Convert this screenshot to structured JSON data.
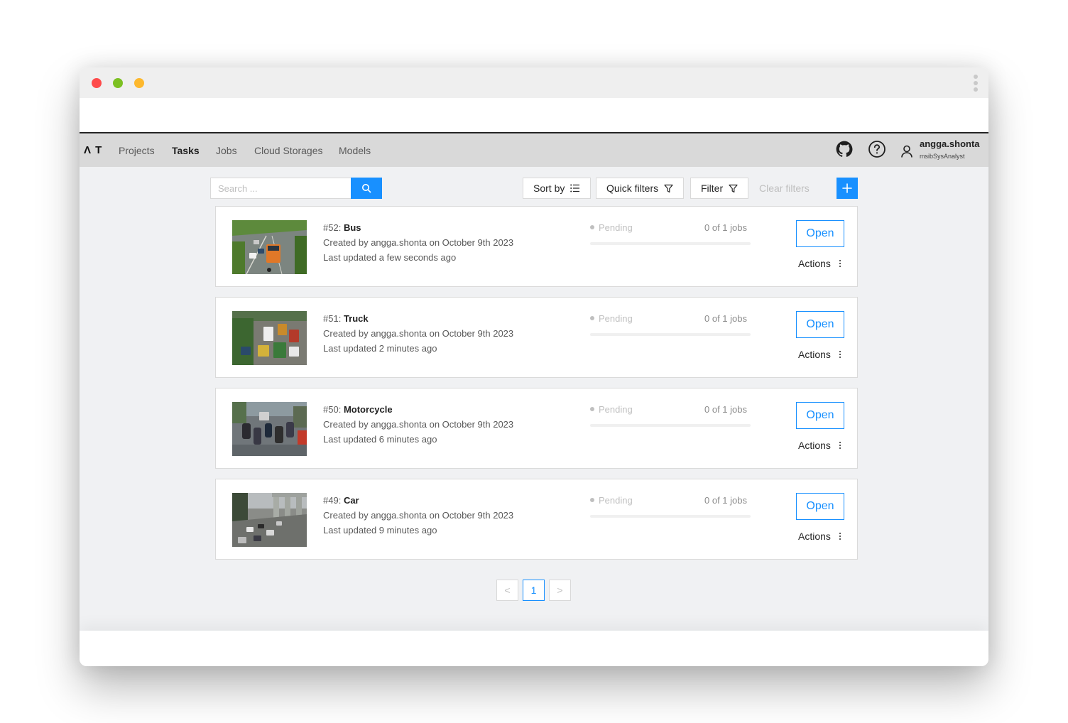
{
  "header": {
    "logo": "Λ T",
    "nav": [
      {
        "label": "Projects",
        "active": false
      },
      {
        "label": "Tasks",
        "active": true
      },
      {
        "label": "Jobs",
        "active": false
      },
      {
        "label": "Cloud Storages",
        "active": false
      },
      {
        "label": "Models",
        "active": false
      }
    ],
    "icons": [
      "github-icon",
      "help-icon",
      "user-icon"
    ],
    "user": {
      "name": "angga.shonta",
      "role": "msibSysAnalyst"
    }
  },
  "toolbar": {
    "search_placeholder": "Search ...",
    "sort_label": "Sort by",
    "quick_filters_label": "Quick filters",
    "filter_label": "Filter",
    "clear_filters_label": "Clear filters"
  },
  "tasks": [
    {
      "id": "#52:",
      "name": "Bus",
      "created": "Created by angga.shonta on October 9th 2023",
      "updated": "Last updated a few seconds ago",
      "status": "Pending",
      "jobs": "0 of 1 jobs",
      "progress": 0,
      "open_label": "Open",
      "actions_label": "Actions"
    },
    {
      "id": "#51:",
      "name": "Truck",
      "created": "Created by angga.shonta on October 9th 2023",
      "updated": "Last updated 2 minutes ago",
      "status": "Pending",
      "jobs": "0 of 1 jobs",
      "progress": 0,
      "open_label": "Open",
      "actions_label": "Actions"
    },
    {
      "id": "#50:",
      "name": "Motorcycle",
      "created": "Created by angga.shonta on October 9th 2023",
      "updated": "Last updated 6 minutes ago",
      "status": "Pending",
      "jobs": "0 of 1 jobs",
      "progress": 0,
      "open_label": "Open",
      "actions_label": "Actions"
    },
    {
      "id": "#49:",
      "name": "Car",
      "created": "Created by angga.shonta on October 9th 2023",
      "updated": "Last updated 9 minutes ago",
      "status": "Pending",
      "jobs": "0 of 1 jobs",
      "progress": 0,
      "open_label": "Open",
      "actions_label": "Actions"
    }
  ],
  "pagination": {
    "prev": "<",
    "current": "1",
    "next": ">"
  },
  "colors": {
    "accent": "#1890ff",
    "nav_bg": "#d9d9d9",
    "content_bg": "#f0f1f3",
    "pending": "#bfbfbf"
  }
}
